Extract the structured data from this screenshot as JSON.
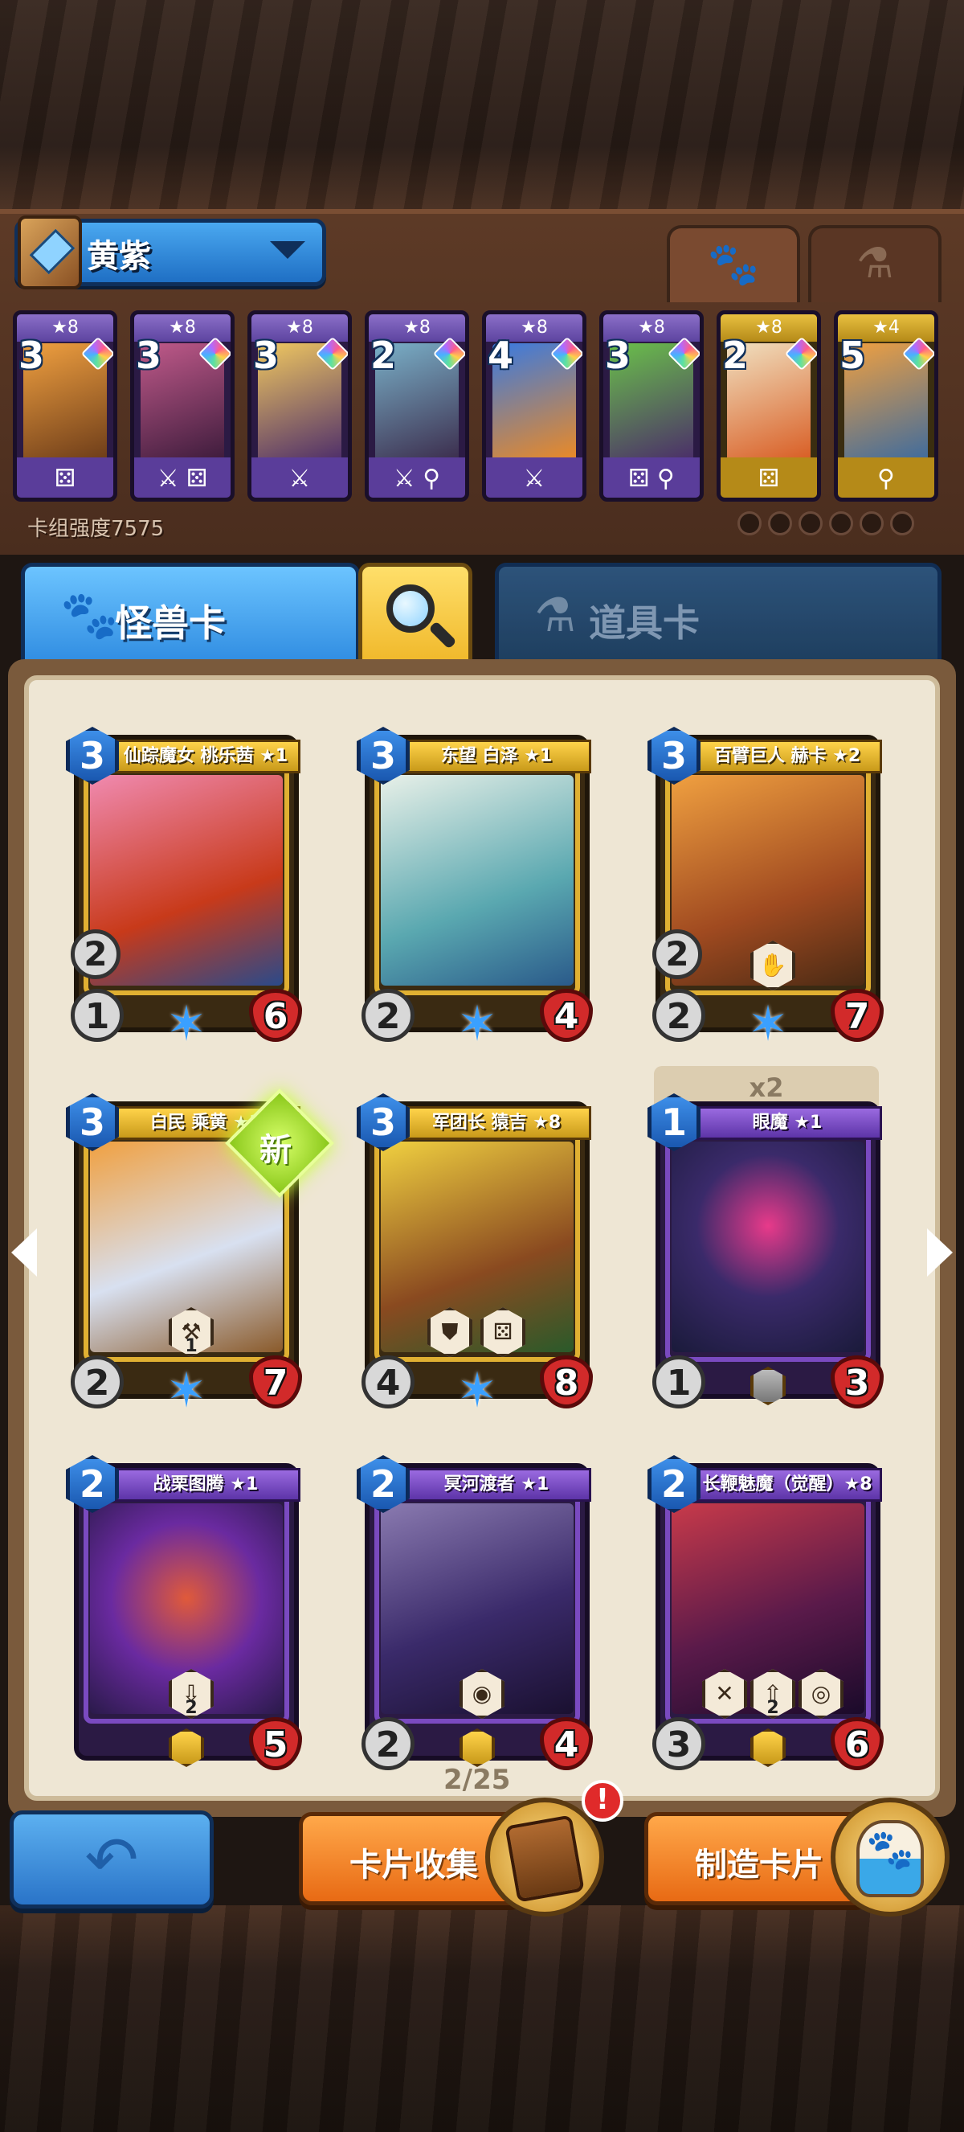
{
  "deck": {
    "name": "黄紫",
    "strength_label": "卡组强度7575",
    "cards": [
      {
        "stars": "★8",
        "cost": "3",
        "tools": "⚄",
        "rarity": "purple"
      },
      {
        "stars": "★8",
        "cost": "3",
        "tools": "⚔ ⚄",
        "rarity": "purple"
      },
      {
        "stars": "★8",
        "cost": "3",
        "tools": "⚔",
        "rarity": "purple"
      },
      {
        "stars": "★8",
        "cost": "2",
        "tools": "⚔ ⚲",
        "rarity": "purple"
      },
      {
        "stars": "★8",
        "cost": "4",
        "tools": "⚔",
        "rarity": "purple"
      },
      {
        "stars": "★8",
        "cost": "3",
        "tools": "⚄ ⚲",
        "rarity": "purple"
      },
      {
        "stars": "★8",
        "cost": "2",
        "tools": "⚄",
        "rarity": "gold"
      },
      {
        "stars": "★4",
        "cost": "5",
        "tools": "⚲",
        "rarity": "gold"
      }
    ]
  },
  "tabs": {
    "monster_label": "怪兽卡",
    "item_label": "道具卡"
  },
  "collection": {
    "cards": [
      {
        "name": "仙踪魔女 桃乐茜 ★1",
        "cost": "3",
        "attack": "1",
        "armor": "2",
        "hp": "6",
        "abilities": [],
        "rarity": "gold"
      },
      {
        "name": "东望 白泽 ★1",
        "cost": "3",
        "attack": "2",
        "armor": "",
        "hp": "4",
        "abilities": [],
        "rarity": "gold"
      },
      {
        "name": "百臂巨人 赫卡 ★2",
        "cost": "3",
        "attack": "2",
        "armor": "2",
        "hp": "7",
        "abilities": [
          {
            "icon": "✋",
            "value": ""
          }
        ],
        "rarity": "gold"
      },
      {
        "name": "白民 乘黄 ★1",
        "cost": "3",
        "attack": "2",
        "armor": "",
        "hp": "7",
        "abilities": [
          {
            "icon": "⚒",
            "value": "1"
          }
        ],
        "rarity": "gold",
        "is_new": true
      },
      {
        "name": "军团长 猿吉 ★8",
        "cost": "3",
        "attack": "4",
        "armor": "",
        "hp": "8",
        "abilities": [
          {
            "icon": "⛊",
            "value": ""
          },
          {
            "icon": "⚄",
            "value": ""
          }
        ],
        "rarity": "gold"
      },
      {
        "name": "眼魔 ★1",
        "cost": "1",
        "attack": "1",
        "armor": "",
        "hp": "3",
        "abilities": [],
        "rarity": "purple"
      },
      {
        "name": "战栗图腾 ★1",
        "cost": "2",
        "attack": "",
        "armor": "",
        "hp": "5",
        "abilities": [
          {
            "icon": "⇩",
            "value": "2"
          }
        ],
        "rarity": "purple"
      },
      {
        "name": "冥河渡者 ★1",
        "cost": "2",
        "attack": "2",
        "armor": "",
        "hp": "4",
        "abilities": [
          {
            "icon": "◉",
            "value": ""
          }
        ],
        "rarity": "purple"
      },
      {
        "name": "长鞭魅魔（觉醒）★8",
        "cost": "2",
        "attack": "3",
        "armor": "",
        "hp": "6",
        "abilities": [
          {
            "icon": "✕",
            "value": ""
          },
          {
            "icon": "⇧",
            "value": "2"
          },
          {
            "icon": "◎",
            "value": ""
          }
        ],
        "rarity": "purple"
      }
    ],
    "new_badge": "新",
    "dup_count": "x2",
    "page": "2/25"
  },
  "bottom_bar": {
    "collect_label": "卡片收集",
    "craft_label": "制造卡片",
    "alert": "!"
  },
  "colors": {
    "accent_blue": "#2d8ae0",
    "accent_orange": "#e86a14",
    "gold_frame": "#e0b032",
    "purple_frame": "#7a4ac0",
    "hp_red": "#d22a2a"
  }
}
